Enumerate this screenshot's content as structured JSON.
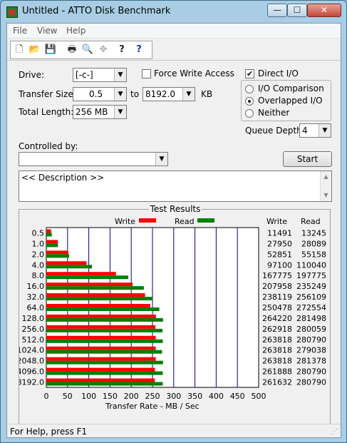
{
  "window": {
    "title": "Untitled - ATTO Disk Benchmark",
    "min": "—",
    "max": "☐",
    "close": "✕"
  },
  "menu": {
    "file": "File",
    "view": "View",
    "help": "Help"
  },
  "toolbar": {
    "new": "🗋",
    "open": "📂",
    "save": "💾",
    "print": "🖶",
    "preview": "🔍",
    "move": "✥",
    "help": "?",
    "context_help": "?"
  },
  "controls": {
    "drive_label": "Drive:",
    "drive_value": "[-c-]",
    "force_write_label": "Force Write Access",
    "direct_io_label": "Direct I/O",
    "direct_io_checked": true,
    "force_write_checked": false,
    "transfer_size_label": "Transfer Size:",
    "transfer_from": "0.5",
    "to_label": "to",
    "transfer_to": "8192.0",
    "kb_label": "KB",
    "total_length_label": "Total Length:",
    "total_length_value": "256 MB",
    "io_comparison_label": "I/O Comparison",
    "overlapped_io_label": "Overlapped I/O",
    "neither_label": "Neither",
    "selected_mode": "Overlapped I/O",
    "queue_depth_label": "Queue Depth:",
    "queue_depth_value": "4",
    "controlled_by_label": "Controlled by:",
    "controlled_by_value": "",
    "start_label": "Start",
    "description": "<< Description >>"
  },
  "colors": {
    "write": "#ff0000",
    "read": "#008000"
  },
  "chart_data": {
    "type": "bar",
    "title": "Test Results",
    "xlabel": "Transfer Rate - MB / Sec",
    "xlim": [
      0,
      500
    ],
    "x_ticks": [
      "0",
      "50",
      "100",
      "150",
      "200",
      "250",
      "300",
      "350",
      "400",
      "450",
      "500"
    ],
    "categories": [
      "0.5",
      "1.0",
      "2.0",
      "4.0",
      "8.0",
      "16.0",
      "32.0",
      "64.0",
      "128.0",
      "256.0",
      "512.0",
      "1024.0",
      "2048.0",
      "4096.0",
      "8192.0"
    ],
    "legend": [
      "Write",
      "Read"
    ],
    "column_headers": [
      "Write",
      "Read"
    ],
    "series": [
      {
        "name": "Write",
        "values_kb": [
          11491,
          27950,
          52851,
          97100,
          167775,
          207958,
          238119,
          250478,
          264220,
          262918,
          263818,
          263818,
          263818,
          261888,
          261632
        ]
      },
      {
        "name": "Read",
        "values_kb": [
          13245,
          28089,
          55158,
          110040,
          197775,
          235249,
          256109,
          272554,
          281498,
          280059,
          280790,
          279038,
          281378,
          280790,
          280790
        ]
      }
    ]
  },
  "status": {
    "text": "For Help, press F1"
  }
}
